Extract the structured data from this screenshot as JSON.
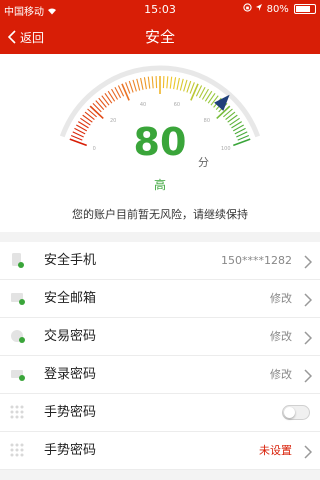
{
  "status_bar": {
    "carrier": "中国移动",
    "wifi_icon": "wifi-icon",
    "time": "15:03",
    "battery_percent": "80%",
    "battery_level": 0.8
  },
  "nav": {
    "back_label": "返回",
    "title": "安全"
  },
  "security": {
    "score": "80",
    "score_value": 80,
    "unit": "分",
    "level": "高",
    "message": "您的账户目前暂无风险，请继续保持",
    "gauge_ticks": [
      "0",
      "20",
      "40",
      "60",
      "80",
      "100"
    ],
    "colors": {
      "accent": "#d81e06",
      "good": "#3aa53a",
      "needle": "#1f3f7a"
    }
  },
  "settings": {
    "items": [
      {
        "label": "安全手机",
        "value": "150****1282",
        "icon": "phone-icon"
      },
      {
        "label": "安全邮箱",
        "value": "修改",
        "icon": "mail-icon"
      },
      {
        "label": "交易密码",
        "value": "修改",
        "icon": "lock-icon"
      },
      {
        "label": "登录密码",
        "value": "修改",
        "icon": "key-icon"
      },
      {
        "label": "手势密码",
        "value": "",
        "icon": "gesture-icon",
        "toggle": false
      },
      {
        "label": "手势密码",
        "value": "未设置",
        "icon": "gesture-icon"
      }
    ]
  }
}
